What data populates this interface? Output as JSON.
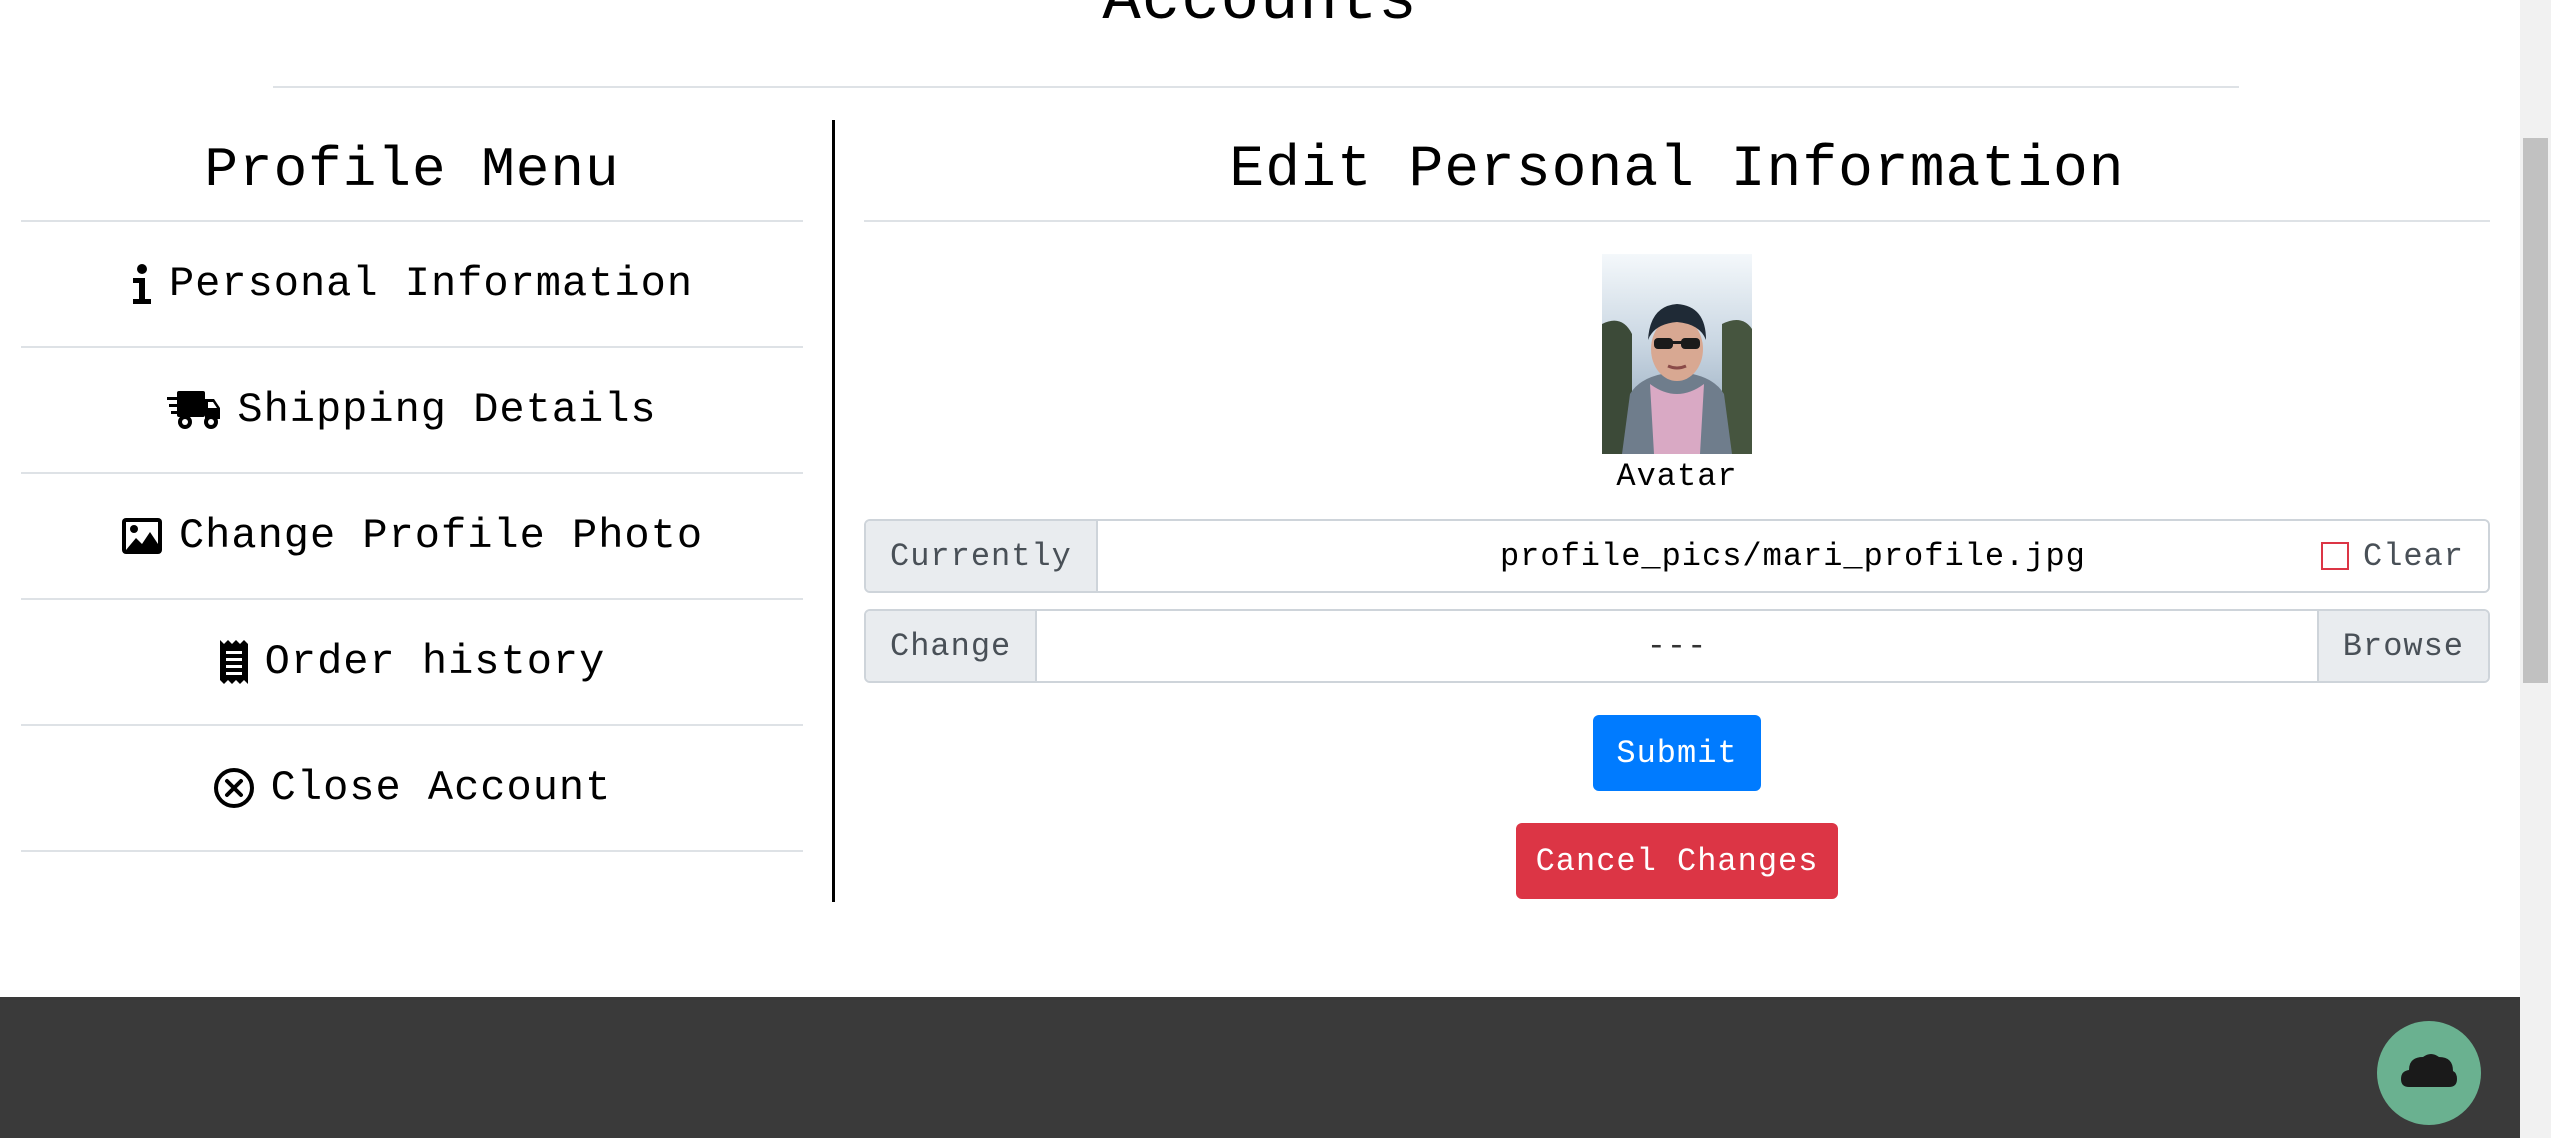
{
  "page": {
    "heading": "Accounts"
  },
  "sidebar": {
    "title": "Profile Menu",
    "items": [
      {
        "label": "Personal Information",
        "icon": "info-icon"
      },
      {
        "label": "Shipping Details",
        "icon": "shipping-truck-icon"
      },
      {
        "label": "Change Profile Photo",
        "icon": "image-icon"
      },
      {
        "label": "Order history",
        "icon": "receipt-icon"
      },
      {
        "label": "Close Account",
        "icon": "close-circle-icon"
      }
    ]
  },
  "main": {
    "title": "Edit Personal Information",
    "avatar": {
      "label": "Avatar"
    },
    "currently": {
      "label": "Currently",
      "value": "profile_pics/mari_profile.jpg",
      "clear_label": "Clear",
      "clear_checked": false
    },
    "change": {
      "label": "Change",
      "value": "---",
      "browse_label": "Browse"
    },
    "buttons": {
      "submit": "Submit",
      "cancel": "Cancel Changes"
    }
  },
  "footer": {
    "scroll_top_icon": "cloud-up-icon"
  },
  "colors": {
    "submit": "#007bff",
    "cancel": "#dc3545",
    "footer": "#3a3a3a",
    "scroll_top_button": "#6ab190",
    "divider": "#dee2e6"
  }
}
